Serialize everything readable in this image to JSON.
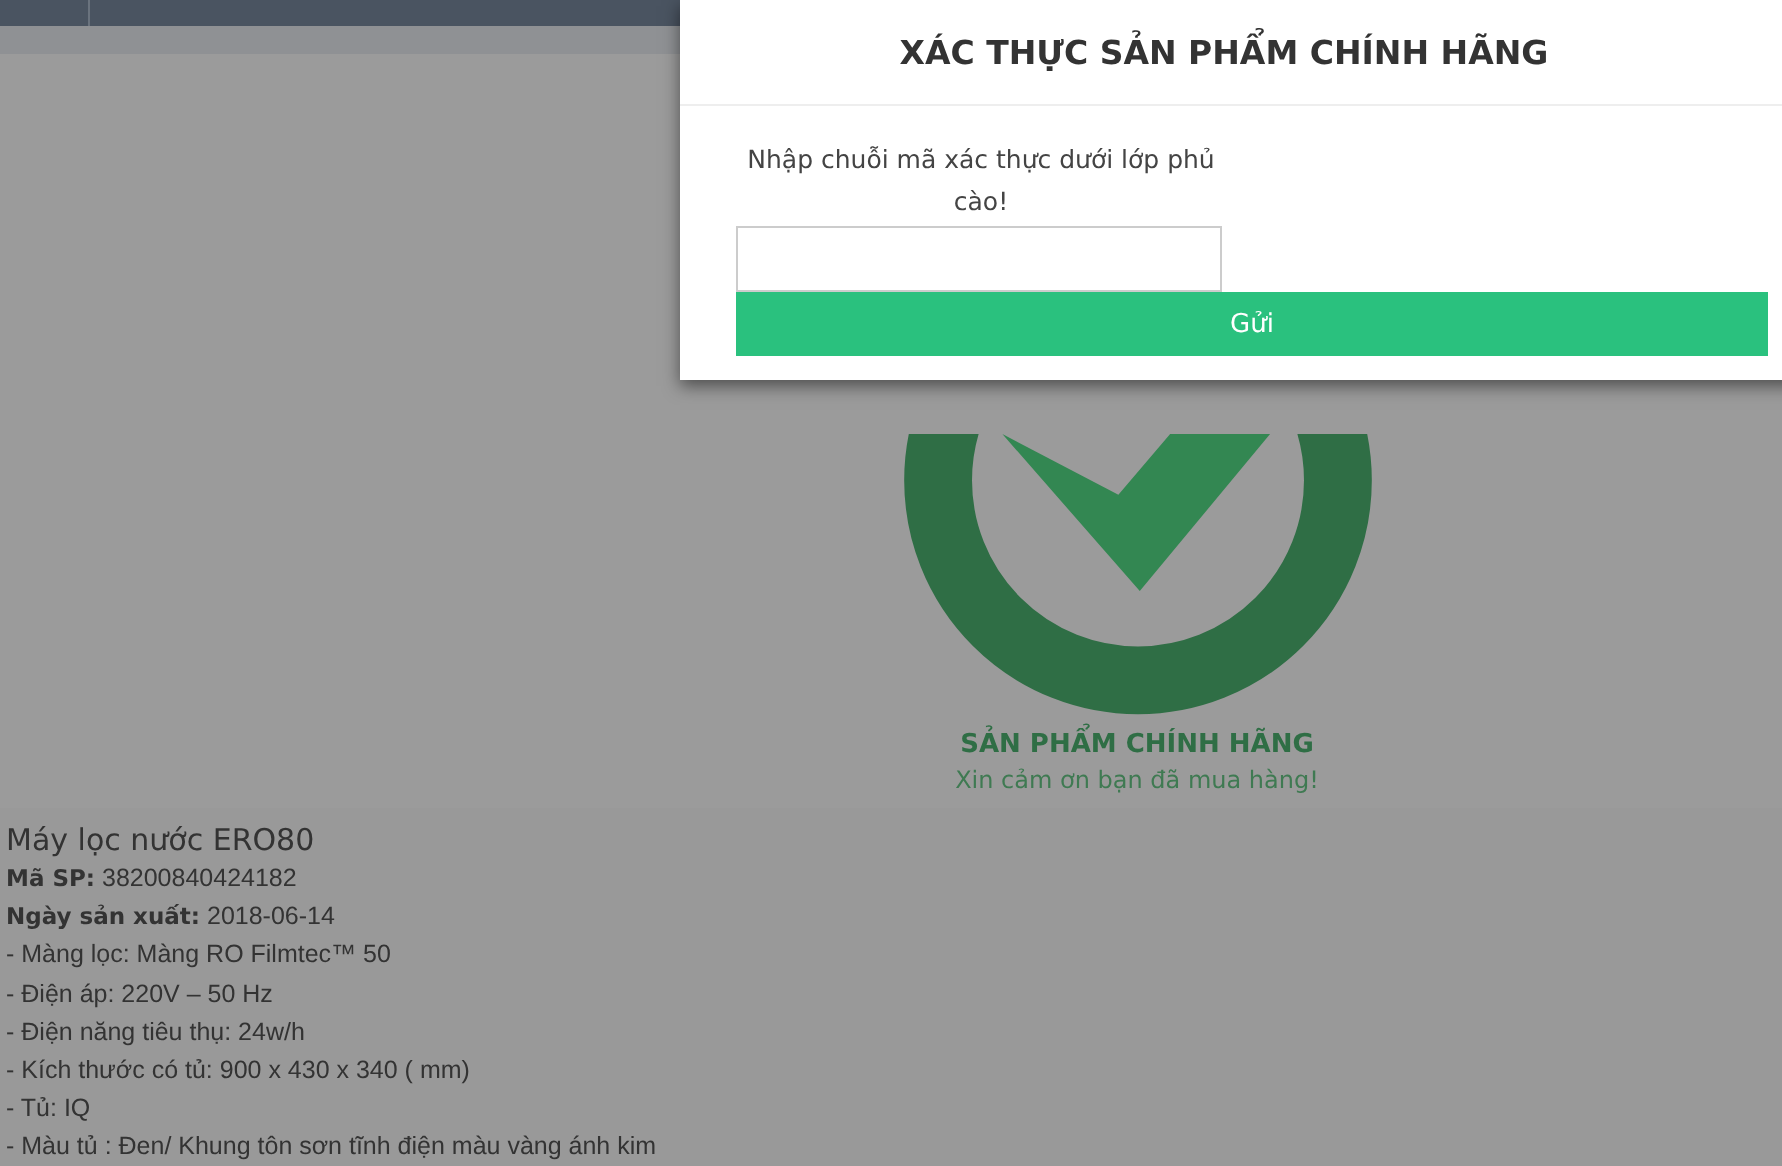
{
  "result": {
    "title": "SẢN PHẨM CHÍNH HÃNG",
    "subtitle": "Xin cảm ơn bạn đã mua hàng!"
  },
  "product": {
    "name": "Máy lọc nước ERO80",
    "fields": [
      {
        "label": "Mã SP:",
        "value": "38200840424182"
      },
      {
        "label": "Ngày sản xuất:",
        "value": "2018-06-14"
      }
    ],
    "specs": [
      "- Màng lọc: Màng RO Filmtec™ 50",
      "- Điện áp: 220V – 50 Hz",
      "- Điện năng tiêu thụ: 24w/h",
      "- Kích thước có tủ: 900 x 430 x 340 ( mm)",
      "- Tủ: IQ",
      "- Màu tủ : Đen/ Khung tôn sơn tĩnh điện màu vàng ánh kim"
    ]
  },
  "modal": {
    "title": "XÁC THỰC SẢN PHẨM CHÍNH HÃNG",
    "prompt": "Nhập chuỗi mã xác thực dưới lớp phủ cào!",
    "submit": "Gửi"
  }
}
